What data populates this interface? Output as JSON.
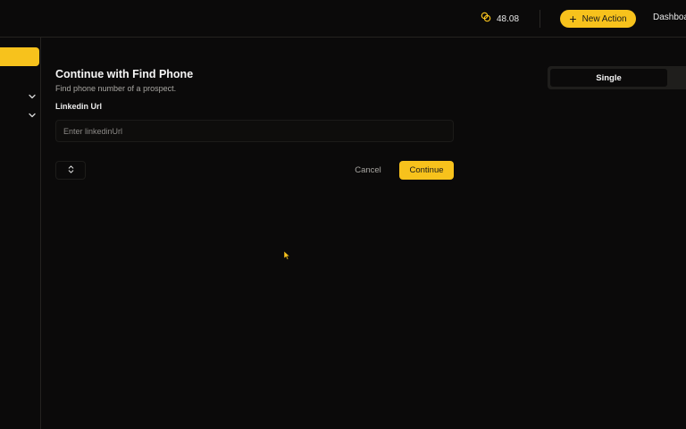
{
  "topbar": {
    "credits_value": "48.08",
    "new_action_label": "New Action",
    "dashboard_label": "Dashboard"
  },
  "form": {
    "title": "Continue with Find Phone",
    "subtitle": "Find phone number of a prospect.",
    "field_label": "Linkedin Url",
    "input_placeholder": "Enter linkedinUrl",
    "input_value": "",
    "cancel_label": "Cancel",
    "continue_label": "Continue"
  },
  "mode_toggle": {
    "single_label": "Single"
  },
  "icons": {
    "credits": "coins-icon",
    "new_action": "plus-icon",
    "sidebar_expand": "chevron-down-icon",
    "stepper": "chevron-up-down-icon",
    "pointer": "cursor-icon"
  },
  "colors": {
    "accent": "#f7c21c",
    "background": "#0b0a0a",
    "muted_text": "#a8a6a2"
  }
}
